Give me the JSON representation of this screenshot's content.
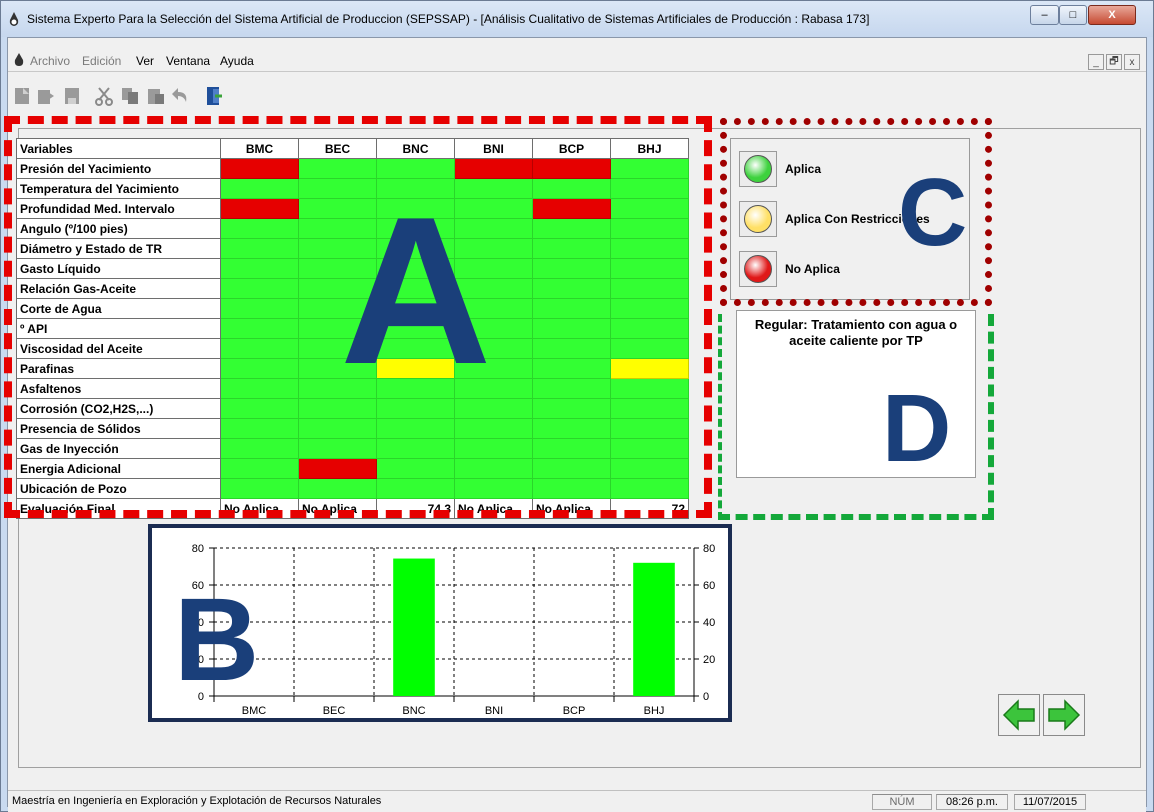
{
  "window": {
    "title": "Sistema Experto Para la Selección del Sistema Artificial de Produccion (SEPSSAP) - [Análisis Cualitativo de Sistemas Artificiales de Producción : Rabasa 173]",
    "min_label": "–",
    "max_label": "□",
    "close_label": "X"
  },
  "menu": {
    "items": [
      {
        "label": "Archivo",
        "enabled": false
      },
      {
        "label": "Edición",
        "enabled": false
      },
      {
        "label": "Ver",
        "enabled": true
      },
      {
        "label": "Ventana",
        "enabled": true
      },
      {
        "label": "Ayuda",
        "enabled": true
      }
    ],
    "mdi_min": "_",
    "mdi_restore": "🗗",
    "mdi_close": "x"
  },
  "toolbar": {
    "icons": [
      "new-icon",
      "open-icon",
      "save-icon",
      "cut-icon",
      "copy-icon",
      "paste-icon",
      "undo-icon",
      "exit-icon"
    ]
  },
  "grid": {
    "header": "Variables",
    "columns": [
      "BMC",
      "BEC",
      "BNC",
      "BNI",
      "BCP",
      "BHJ"
    ],
    "rows": [
      {
        "label": "Presión del Yacimiento",
        "cells": [
          "r",
          "g",
          "g",
          "r",
          "r",
          "g"
        ]
      },
      {
        "label": "Temperatura del Yacimiento",
        "cells": [
          "g",
          "g",
          "g",
          "g",
          "g",
          "g"
        ]
      },
      {
        "label": "Profundidad Med. Intervalo",
        "cells": [
          "r",
          "g",
          "g",
          "g",
          "r",
          "g"
        ]
      },
      {
        "label": "Angulo (º/100 pies)",
        "cells": [
          "g",
          "g",
          "g",
          "g",
          "g",
          "g"
        ]
      },
      {
        "label": "Diámetro y Estado de TR",
        "cells": [
          "g",
          "g",
          "g",
          "g",
          "g",
          "g"
        ]
      },
      {
        "label": "Gasto Líquido",
        "cells": [
          "g",
          "g",
          "g",
          "g",
          "g",
          "g"
        ]
      },
      {
        "label": "Relación Gas-Aceite",
        "cells": [
          "g",
          "g",
          "g",
          "g",
          "g",
          "g"
        ]
      },
      {
        "label": "Corte de Agua",
        "cells": [
          "g",
          "g",
          "g",
          "g",
          "g",
          "g"
        ]
      },
      {
        "label": "º API",
        "cells": [
          "g",
          "g",
          "g",
          "g",
          "g",
          "g"
        ]
      },
      {
        "label": "Viscosidad del Aceite",
        "cells": [
          "g",
          "g",
          "g",
          "g",
          "g",
          "g"
        ]
      },
      {
        "label": "Parafinas",
        "cells": [
          "g",
          "g",
          "ys",
          "g",
          "g",
          "y"
        ]
      },
      {
        "label": "Asfaltenos",
        "cells": [
          "g",
          "g",
          "g",
          "g",
          "g",
          "g"
        ]
      },
      {
        "label": "Corrosión (CO2,H2S,...)",
        "cells": [
          "g",
          "g",
          "g",
          "g",
          "g",
          "g"
        ]
      },
      {
        "label": "Presencia de Sólidos",
        "cells": [
          "g",
          "g",
          "g",
          "g",
          "g",
          "g"
        ]
      },
      {
        "label": "Gas de Inyección",
        "cells": [
          "g",
          "g",
          "g",
          "g",
          "g",
          "g"
        ]
      },
      {
        "label": "Energia Adicional",
        "cells": [
          "g",
          "r",
          "g",
          "g",
          "g",
          "g"
        ]
      },
      {
        "label": "Ubicación de Pozo",
        "cells": [
          "g",
          "g",
          "g",
          "g",
          "g",
          "g"
        ]
      }
    ],
    "final_label": "Evaluación Final",
    "final_values": [
      "No Aplica",
      "No Aplica",
      "74.3",
      "No Aplica",
      "No Aplica",
      "72"
    ]
  },
  "legend": {
    "items": [
      {
        "label": "Aplica",
        "color": "#3ed23e"
      },
      {
        "label": "Aplica Con Restricciones",
        "color": "#ffe066"
      },
      {
        "label": "No Aplica",
        "color": "#e01818"
      }
    ]
  },
  "recommendation": {
    "text": "Regular: Tratamiento con agua o aceite caliente por TP"
  },
  "chart_data": {
    "type": "bar",
    "categories": [
      "BMC",
      "BEC",
      "BNC",
      "BNI",
      "BCP",
      "BHJ"
    ],
    "values": [
      0,
      0,
      74.3,
      0,
      0,
      72
    ],
    "ylim": [
      0,
      80
    ],
    "yticks": [
      0,
      20,
      40,
      60,
      80
    ],
    "grid": true,
    "bar_color": "#00ff00"
  },
  "nav": {
    "back_icon": "arrow-left-icon",
    "forward_icon": "arrow-right-icon"
  },
  "status": {
    "text": "Maestría en Ingeniería en Exploración y Explotación de Recursos Naturales",
    "num": "NÚM",
    "time": "08:26 p.m.",
    "date": "11/07/2015"
  },
  "annotations": {
    "a": "A",
    "b": "B",
    "c": "C",
    "d": "D"
  }
}
